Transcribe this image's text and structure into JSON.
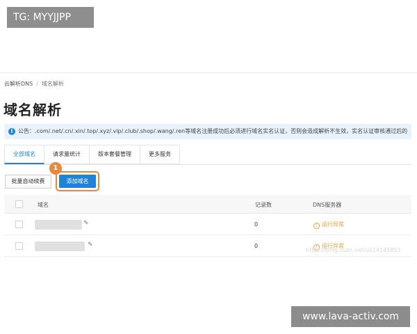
{
  "watermark_top": "TG: MYYJJPP",
  "watermark_bottom": "www.lava-activ.com",
  "watermark_faint": "https://blog.csdn.net/u014145853",
  "breadcrumb": {
    "root": "云解析DNS",
    "separator": "/",
    "current": "域名解析"
  },
  "page_title": "域名解析",
  "notice": {
    "icon": "info-icon",
    "text": "公告：.com/.net/.cn/.xin/.top/.xyz/.vip/.club/.shop/.wang/.ren等域名注册成功后必须进行域名实名认证，否则会造成解析不生效，实名认证审核通过后的"
  },
  "tabs": [
    {
      "label": "全部域名",
      "active": true
    },
    {
      "label": "请求量统计",
      "active": false
    },
    {
      "label": "版本套餐管理",
      "active": false
    },
    {
      "label": "更多服务",
      "active": false
    }
  ],
  "toolbar": {
    "renew_label": "批量自动续费",
    "add_label": "添加域名",
    "step_badge": "1"
  },
  "table": {
    "columns": {
      "domain": "域名",
      "records": "记录数",
      "dns": "DNS服务器"
    },
    "rows": [
      {
        "records": "0",
        "dns_status": "运行异常"
      },
      {
        "records": "0",
        "dns_status": "运行异常"
      }
    ]
  },
  "colors": {
    "accent": "#1f84d8",
    "highlight": "#e8873d",
    "warning": "#e8a033"
  }
}
